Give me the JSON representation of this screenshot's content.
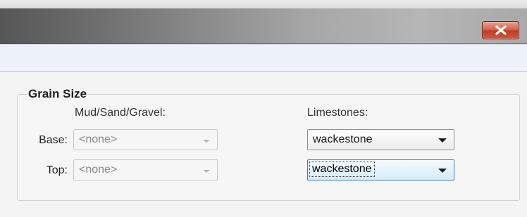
{
  "window": {
    "close_glyph": "x"
  },
  "grain_size": {
    "title": "Grain Size",
    "mud_header": "Mud/Sand/Gravel:",
    "limestone_header": "Limestones:",
    "rows": [
      {
        "label": "Base:",
        "mud_value": "<none>",
        "limestone_value": "wackestone"
      },
      {
        "label": "Top:",
        "mud_value": "<none>",
        "limestone_value": "wackestone"
      }
    ]
  },
  "colors": {
    "close_button": "#c9402b",
    "focus_border": "#3c7fb1"
  }
}
